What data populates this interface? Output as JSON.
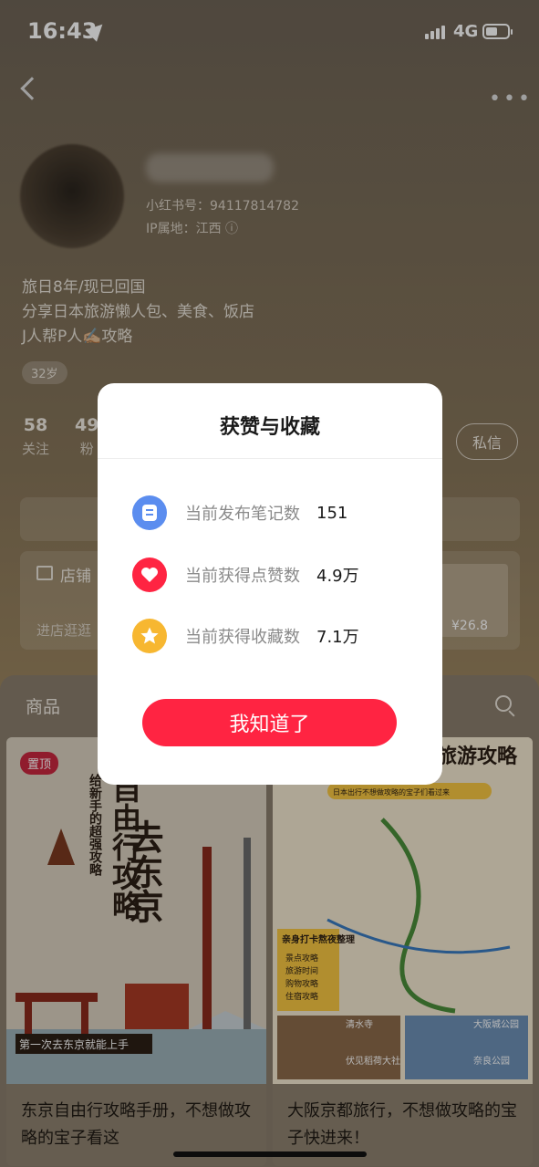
{
  "status_bar": {
    "time": "16:43",
    "network": "4G"
  },
  "profile": {
    "red_id": "小红书号：94117814782",
    "ip_location": "IP属地：江西 ⓘ",
    "bio_lines": [
      "旅日8年/现已回国",
      "分享日本旅游懒人包、美食、饭店",
      "J人帮P人✍🏼攻略"
    ],
    "age": "32岁",
    "stats": [
      {
        "num": "58",
        "label": "关注"
      },
      {
        "num": "49",
        "label": "粉"
      }
    ],
    "dm_label": "私信"
  },
  "shop": {
    "label": "店铺",
    "sub": "进店逛逛",
    "price": "¥26.8"
  },
  "content": {
    "tab": "商品",
    "pin_badge": "置顶",
    "products": [
      {
        "title": "东京自由行攻略手册，不想做攻略的宝子看这"
      },
      {
        "title": "大阪京都旅行，不想做攻略的宝子快进来！"
      }
    ],
    "poster1": {
      "headline": "去东京",
      "sub": "自由行攻略",
      "side": "给新手的超强攻略",
      "banner": "第一次去东京就能上手"
    },
    "poster2": {
      "headline": "旅游攻略",
      "tagline": "日本出行不想做攻略的宝子们看过来",
      "box_title": "亲身打卡熬夜整理",
      "checklist": [
        "景点攻略",
        "旅游时间",
        "购物攻略",
        "住宿攻略"
      ],
      "spots": [
        "清水寺",
        "大阪城公园",
        "伏见稻荷大社",
        "奈良公园"
      ]
    }
  },
  "modal": {
    "title": "获赞与收藏",
    "rows": [
      {
        "label": "当前发布笔记数",
        "value": "151",
        "icon": "note-icon",
        "color": "#5b8def"
      },
      {
        "label": "当前获得点赞数",
        "value": "4.9万",
        "icon": "heart-icon",
        "color": "#ff2442"
      },
      {
        "label": "当前获得收藏数",
        "value": "7.1万",
        "icon": "star-icon",
        "color": "#f7b731"
      }
    ],
    "button": "我知道了"
  }
}
